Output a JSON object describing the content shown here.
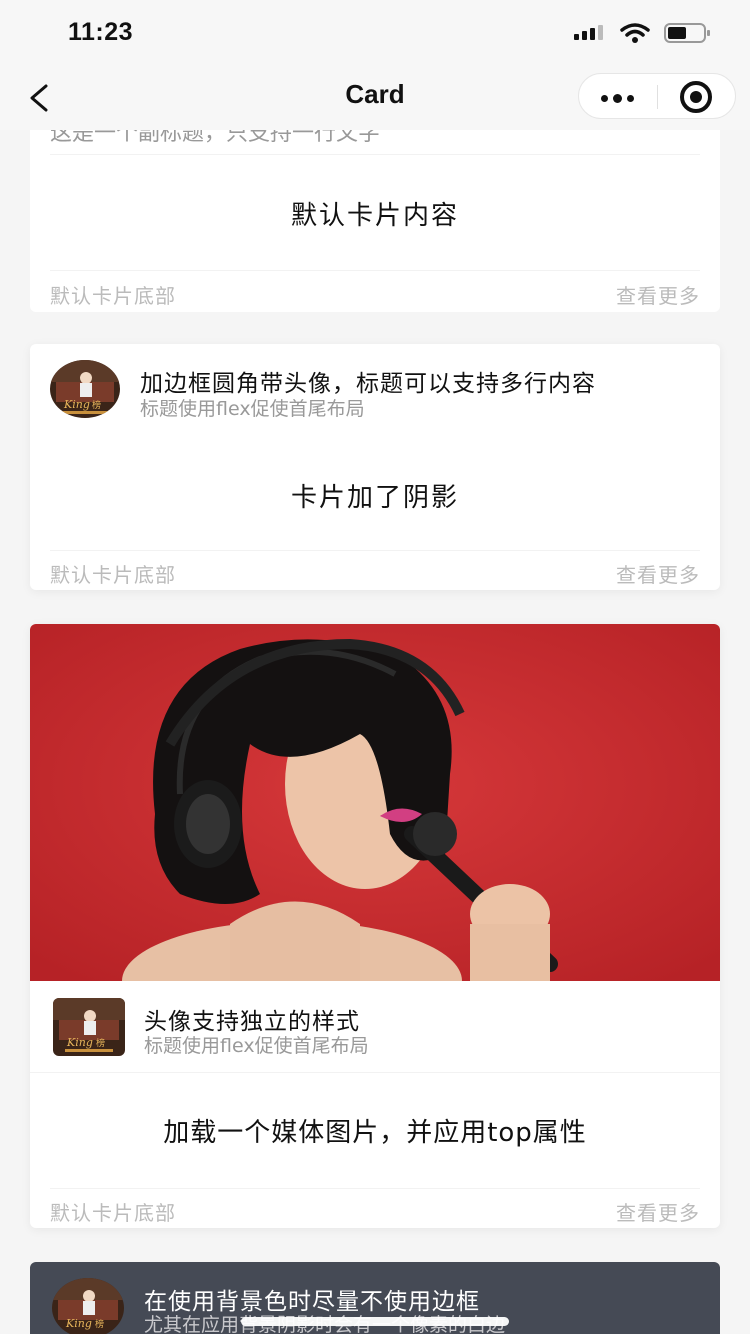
{
  "status_bar": {
    "time": "11:23"
  },
  "nav": {
    "title": "Card"
  },
  "card1": {
    "cut_header": "这是一个副标题，只支持一行文字",
    "body": "默认卡片内容",
    "footer_left": "默认卡片底部",
    "footer_right": "查看更多"
  },
  "card2": {
    "title": "加边框圆角带头像，标题可以支持多行内容",
    "subtitle": "标题使用flex促使首尾布局",
    "body": "卡片加了阴影",
    "footer_left": "默认卡片底部",
    "footer_right": "查看更多"
  },
  "card3": {
    "title": "头像支持独立的样式",
    "subtitle": "标题使用flex促使首尾布局",
    "body": "加载一个媒体图片，并应用top属性",
    "footer_left": "默认卡片底部",
    "footer_right": "查看更多"
  },
  "card4": {
    "title": "在使用背景色时尽量不使用边框",
    "subtitle": "尤其在应用背景阴影时会有一个像素的白边"
  },
  "colors": {
    "media_bg": "#c42a2d",
    "dark_card_bg": "#454a55",
    "page_bg": "#f5f5f5"
  }
}
